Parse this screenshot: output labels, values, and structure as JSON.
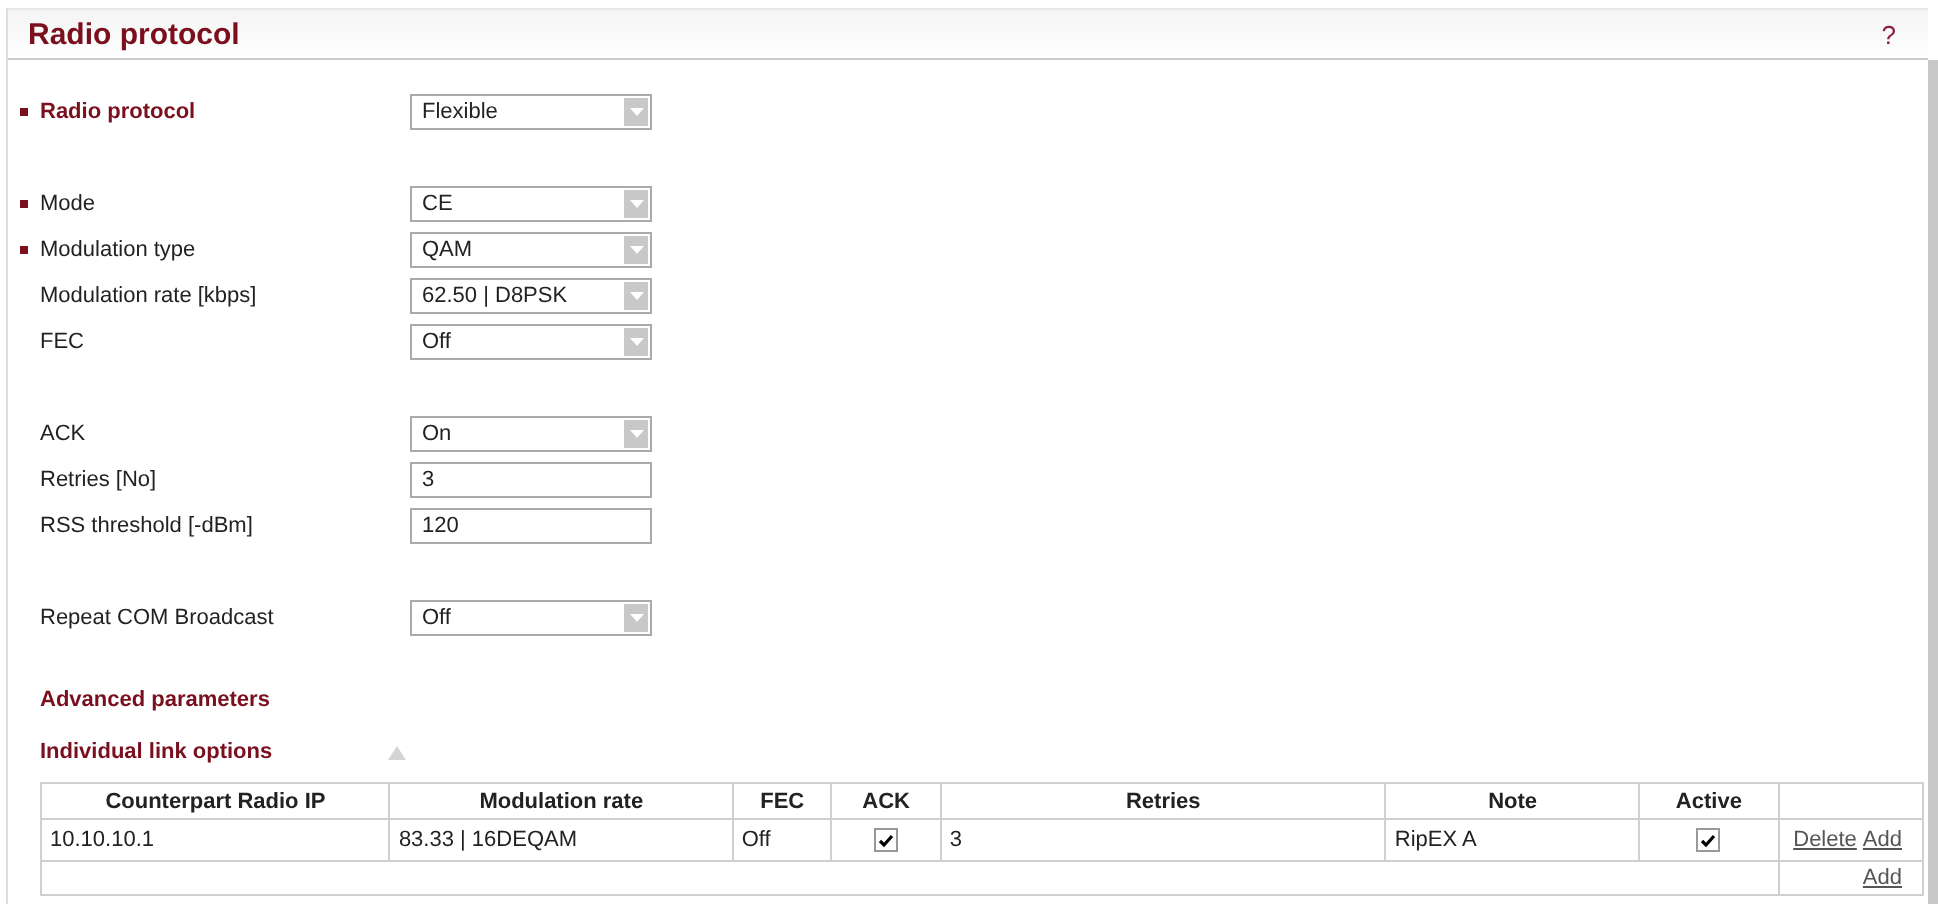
{
  "header": {
    "title": "Radio protocol",
    "help": "?"
  },
  "groups": [
    {
      "fields": [
        {
          "label": "Radio protocol",
          "marked": true,
          "highlighted": true,
          "kind": "select",
          "value": "Flexible"
        }
      ]
    },
    {
      "fields": [
        {
          "label": "Mode",
          "marked": true,
          "highlighted": false,
          "kind": "select",
          "value": "CE"
        },
        {
          "label": "Modulation type",
          "marked": true,
          "highlighted": false,
          "kind": "select",
          "value": "QAM"
        },
        {
          "label": "Modulation rate [kbps]",
          "marked": false,
          "highlighted": false,
          "kind": "select",
          "value": "62.50 | D8PSK"
        },
        {
          "label": "FEC",
          "marked": false,
          "highlighted": false,
          "kind": "select",
          "value": "Off"
        }
      ]
    },
    {
      "fields": [
        {
          "label": "ACK",
          "marked": false,
          "highlighted": false,
          "kind": "select",
          "value": "On"
        },
        {
          "label": "Retries [No]",
          "marked": false,
          "highlighted": false,
          "kind": "input",
          "value": "3"
        },
        {
          "label": "RSS threshold [-dBm]",
          "marked": false,
          "highlighted": false,
          "kind": "input",
          "value": "120"
        }
      ]
    },
    {
      "fields": [
        {
          "label": "Repeat COM Broadcast",
          "marked": false,
          "highlighted": false,
          "kind": "select",
          "value": "Off"
        }
      ]
    }
  ],
  "advanced": {
    "title": "Advanced parameters"
  },
  "link_options": {
    "title": "Individual link options",
    "expanded": true
  },
  "table": {
    "columns": [
      "Counterpart Radio IP",
      "Modulation rate",
      "FEC",
      "ACK",
      "Retries",
      "Note",
      "Active"
    ],
    "rows": [
      {
        "ip": "10.10.10.1",
        "rate": "83.33 | 16DEQAM",
        "fec": "Off",
        "ack": true,
        "retries": "3",
        "note": "RipEX A",
        "active": true,
        "actions": [
          "Delete",
          "Add"
        ]
      }
    ],
    "footer_action": "Add"
  }
}
